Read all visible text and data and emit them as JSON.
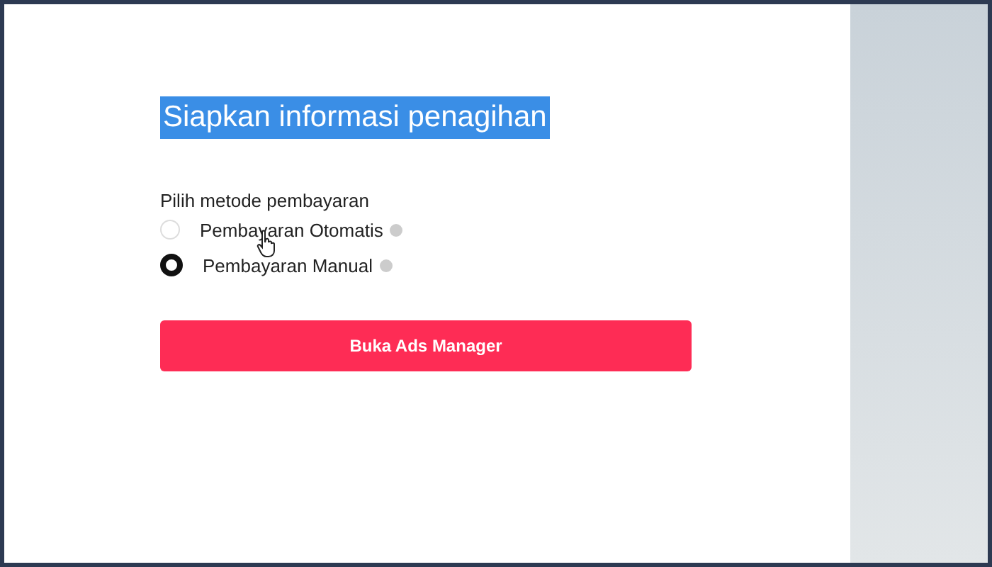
{
  "title": {
    "text": "Siapkan informasi penagihan",
    "highlighted": true
  },
  "payment_method": {
    "label": "Pilih metode pembayaran",
    "options": [
      {
        "label": "Pembayaran Otomatis",
        "selected": false
      },
      {
        "label": "Pembayaran Manual",
        "selected": true
      }
    ]
  },
  "button": "Buka Ads Manager"
}
